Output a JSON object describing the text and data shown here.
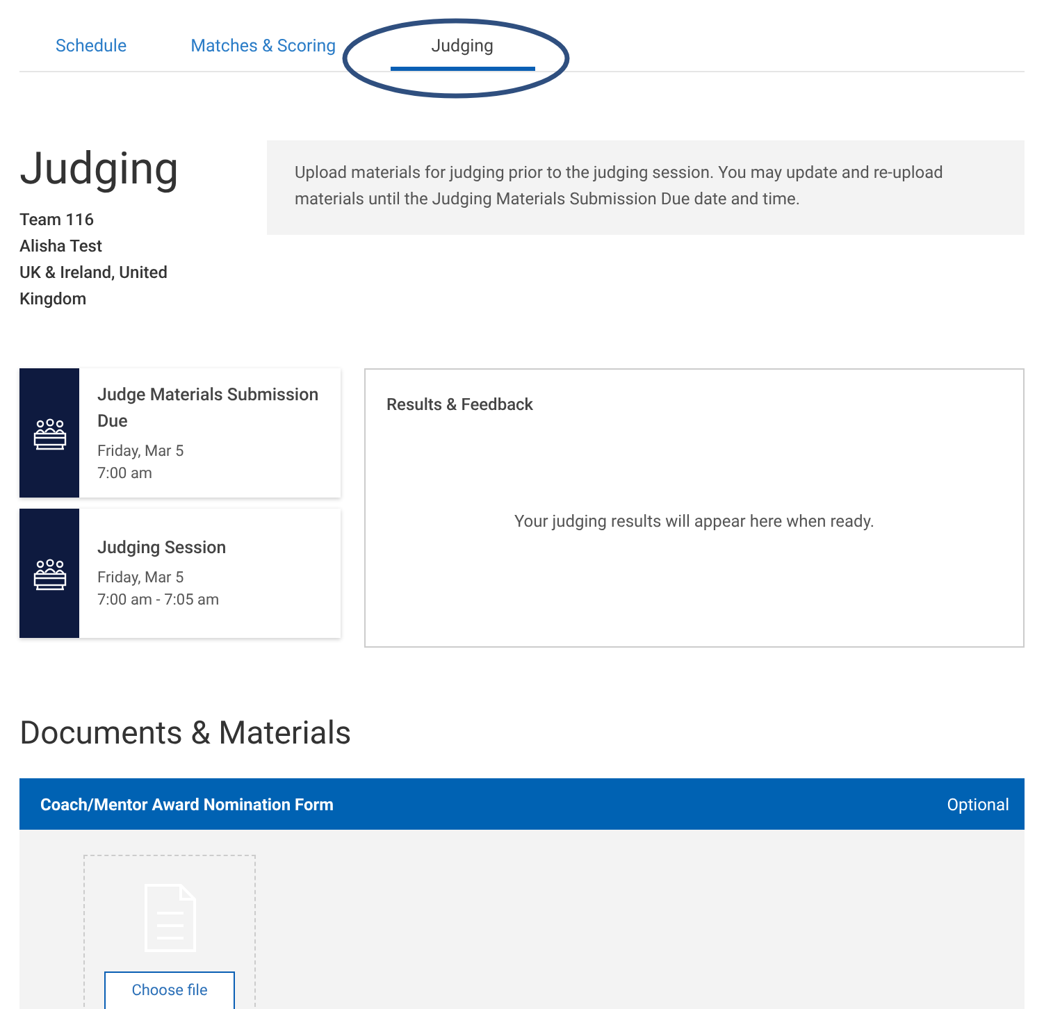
{
  "tabs": [
    {
      "label": "Schedule",
      "selected": false
    },
    {
      "label": "Matches & Scoring",
      "selected": false
    },
    {
      "label": "Judging",
      "selected": true
    }
  ],
  "header": {
    "title": "Judging",
    "lines": [
      "Team 116",
      "Alisha Test",
      "UK & Ireland, United Kingdom"
    ]
  },
  "notice": "Upload materials for judging prior to the judging session. You may update and re-upload materials until the Judging Materials Submission Due date and time.",
  "events": [
    {
      "title": "Judge Materials Submission Due",
      "date": "Friday, Mar 5",
      "time": "7:00 am"
    },
    {
      "title": "Judging Session",
      "date": "Friday, Mar 5",
      "time": "7:00 am - 7:05 am"
    }
  ],
  "results": {
    "title": "Results & Feedback",
    "message": "Your judging results will appear here when ready."
  },
  "documents": {
    "title": "Documents & Materials",
    "items": [
      {
        "title": "Coach/Mentor Award Nomination Form",
        "badge": "Optional",
        "button": "Choose file"
      }
    ]
  }
}
